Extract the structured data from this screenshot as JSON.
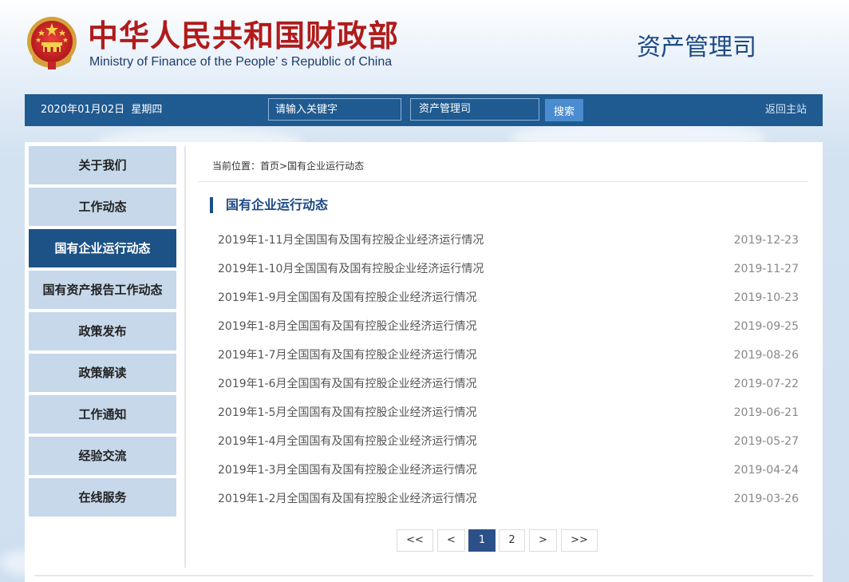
{
  "header": {
    "title_cn": "中华人民共和国财政部",
    "title_en": "Ministry of Finance of the People’ s Republic of China",
    "department": "资产管理司",
    "colors": {
      "title_red": "#b01b1b",
      "brand_blue": "#1f5a91"
    }
  },
  "navbar": {
    "date": "2020年01月02日  星期四",
    "search_placeholder": "请输入关键字",
    "scope": "资产管理司",
    "search_label": "搜索",
    "home_label": "返回主站"
  },
  "sidebar": {
    "items": [
      {
        "label": "关于我们",
        "active": false
      },
      {
        "label": "工作动态",
        "active": false
      },
      {
        "label": "国有企业运行动态",
        "active": true
      },
      {
        "label": "国有资产报告工作动态",
        "active": false
      },
      {
        "label": "政策发布",
        "active": false
      },
      {
        "label": "政策解读",
        "active": false
      },
      {
        "label": "工作通知",
        "active": false
      },
      {
        "label": "经验交流",
        "active": false
      },
      {
        "label": "在线服务",
        "active": false
      }
    ]
  },
  "breadcrumb": {
    "prefix": "当前位置：",
    "home": "首页",
    "separator": ">",
    "current": "国有企业运行动态"
  },
  "section": {
    "title": "国有企业运行动态"
  },
  "news": [
    {
      "title": "2019年1-11月全国国有及国有控股企业经济运行情况",
      "date": "2019-12-23"
    },
    {
      "title": "2019年1-10月全国国有及国有控股企业经济运行情况",
      "date": "2019-11-27"
    },
    {
      "title": "2019年1-9月全国国有及国有控股企业经济运行情况",
      "date": "2019-10-23"
    },
    {
      "title": "2019年1-8月全国国有及国有控股企业经济运行情况",
      "date": "2019-09-25"
    },
    {
      "title": "2019年1-7月全国国有及国有控股企业经济运行情况",
      "date": "2019-08-26"
    },
    {
      "title": "2019年1-6月全国国有及国有控股企业经济运行情况",
      "date": "2019-07-22"
    },
    {
      "title": "2019年1-5月全国国有及国有控股企业经济运行情况",
      "date": "2019-06-21"
    },
    {
      "title": "2019年1-4月全国国有及国有控股企业经济运行情况",
      "date": "2019-05-27"
    },
    {
      "title": "2019年1-3月全国国有及国有控股企业经济运行情况",
      "date": "2019-04-24"
    },
    {
      "title": "2019年1-2月全国国有及国有控股企业经济运行情况",
      "date": "2019-03-26"
    }
  ],
  "pager": {
    "first": "<<",
    "prev": "<",
    "pages": [
      "1",
      "2"
    ],
    "current": "1",
    "next": ">",
    "last": ">>"
  }
}
